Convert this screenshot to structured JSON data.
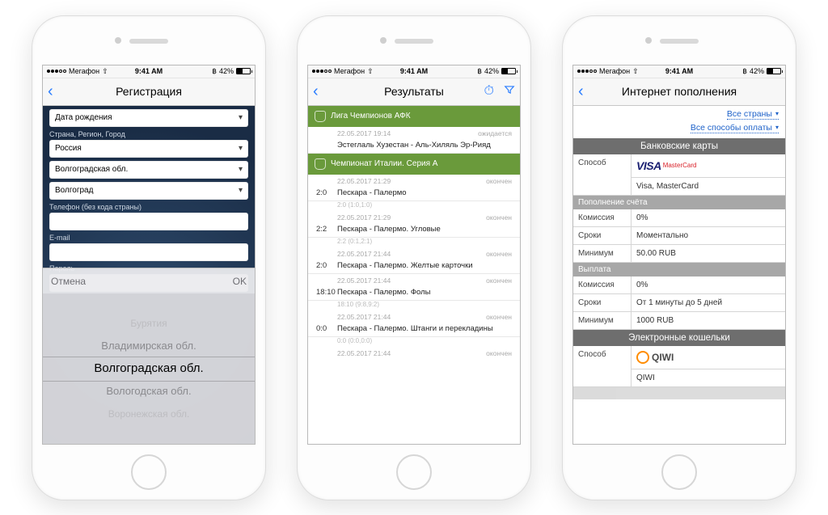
{
  "status_bar": {
    "carrier": "Мегафон",
    "time": "9:41 AM",
    "battery": "42%",
    "wifi_icon": "wifi",
    "bt_icon": "bluetooth"
  },
  "phone1": {
    "nav_title": "Регистрация",
    "fields": {
      "birthdate_label": "Дата рождения",
      "location_label": "Страна, Регион, Город",
      "country": "Россия",
      "region": "Волгоградская обл.",
      "city": "Волгоград",
      "phone_label": "Телефон (без кода страны)",
      "email_label": "E-mail",
      "password_label": "Пароль"
    },
    "picker": {
      "cancel": "Отмена",
      "ok": "OK",
      "options": [
        "Бурятия",
        "Владимирская обл.",
        "Волгоградская обл.",
        "Вологодская обл.",
        "Воронежская обл."
      ],
      "selected": "Волгоградская обл."
    }
  },
  "phone2": {
    "nav_title": "Результаты",
    "groups": [
      {
        "title": "Лига Чемпионов АФК",
        "rows": [
          {
            "dt": "22.05.2017 19:14",
            "status": "ожидается",
            "score": "",
            "name": "Эстеглаль Хузестан - Аль-Хиляль Эр-Рияд",
            "sub": ""
          }
        ]
      },
      {
        "title": "Чемпионат Италии. Серия А",
        "rows": [
          {
            "dt": "22.05.2017 21:29",
            "status": "окончен",
            "score": "2:0",
            "name": "Пескара - Палермо",
            "sub": "2:0 (1:0,1:0)"
          },
          {
            "dt": "22.05.2017 21:29",
            "status": "окончен",
            "score": "2:2",
            "name": "Пескара - Палермо. Угловые",
            "sub": "2:2 (0:1,2:1)"
          },
          {
            "dt": "22.05.2017 21:44",
            "status": "окончен",
            "score": "2:0",
            "name": "Пескара - Палермо. Желтые карточки",
            "sub": ""
          },
          {
            "dt": "22.05.2017 21:44",
            "status": "окончен",
            "score": "18:10",
            "name": "Пескара - Палермо. Фолы",
            "sub": "18:10 (9:8,9:2)"
          },
          {
            "dt": "22.05.2017 21:44",
            "status": "окончен",
            "score": "0:0",
            "name": "Пескара - Палермо. Штанги и перекладины",
            "sub": "0:0 (0:0,0:0)"
          },
          {
            "dt": "22.05.2017 21:44",
            "status": "окончен",
            "score": "",
            "name": "",
            "sub": ""
          }
        ]
      }
    ]
  },
  "phone3": {
    "nav_title": "Интернет пополнения",
    "filter_country": "Все страны",
    "filter_method": "Все способы оплаты",
    "sections": {
      "cards_title": "Банковские карты",
      "method_label": "Способ",
      "cards_method_value": "Visa, MasterCard",
      "deposit_title": "Пополнение счёта",
      "commission_label": "Комиссия",
      "commission_value": "0%",
      "timing_label": "Сроки",
      "deposit_timing_value": "Моментально",
      "minimum_label": "Минимум",
      "deposit_minimum_value": "50.00 RUB",
      "withdraw_title": "Выплата",
      "withdraw_commission_value": "0%",
      "withdraw_timing_value": "От 1 минуты до 5 дней",
      "withdraw_minimum_value": "1000 RUB",
      "ewallets_title": "Электронные кошельки",
      "qiwi_value": "QIWI"
    }
  }
}
